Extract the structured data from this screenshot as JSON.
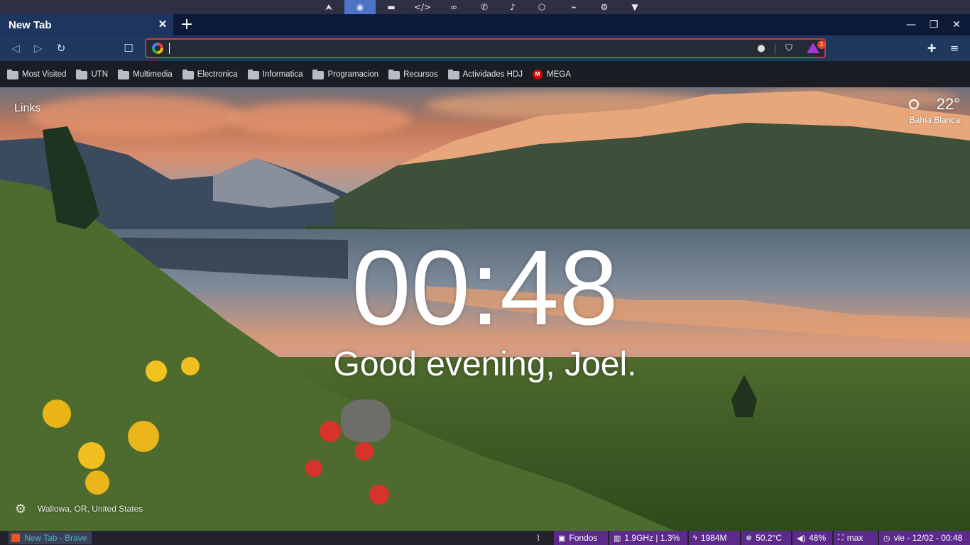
{
  "dock": {
    "items": [
      {
        "icon": "arrow-up-icon",
        "glyph": "⮝"
      },
      {
        "icon": "firefox-icon",
        "glyph": "◉",
        "active": true
      },
      {
        "icon": "folder-icon",
        "glyph": "▬"
      },
      {
        "icon": "code-icon",
        "glyph": "</>"
      },
      {
        "icon": "infinity-icon",
        "glyph": "∞"
      },
      {
        "icon": "whatsapp-icon",
        "glyph": "✆"
      },
      {
        "icon": "music-icon",
        "glyph": "♪"
      },
      {
        "icon": "cube-icon",
        "glyph": "⬡"
      },
      {
        "icon": "plug-icon",
        "glyph": "⌁"
      },
      {
        "icon": "gear-icon",
        "glyph": "⚙"
      },
      {
        "icon": "brave-icon",
        "glyph": "▼"
      }
    ]
  },
  "browser": {
    "tab_title": "New Tab",
    "close_glyph": "✕",
    "newtab_glyph": "+",
    "window_controls": {
      "minimize": "—",
      "restore": "❐",
      "close": "✕"
    }
  },
  "toolbar": {
    "back": "◁",
    "forward": "▷",
    "reload": "↻",
    "bookmark": "☐",
    "url_value": "",
    "url_placeholder": "",
    "location_glyph": "⬤",
    "shield_glyph": "⛉",
    "rewards_badge": "1",
    "extensions_glyph": "✚",
    "menu_glyph": "≡"
  },
  "bookmarks": [
    {
      "label": "Most Visited",
      "type": "folder"
    },
    {
      "label": "UTN",
      "type": "folder"
    },
    {
      "label": "Multimedia",
      "type": "folder"
    },
    {
      "label": "Electronica",
      "type": "folder"
    },
    {
      "label": "Informatica",
      "type": "folder"
    },
    {
      "label": "Programacion",
      "type": "folder"
    },
    {
      "label": "Recursos",
      "type": "folder"
    },
    {
      "label": "Actividades HDJ",
      "type": "folder"
    },
    {
      "label": "MEGA",
      "type": "link",
      "icon_text": "M"
    }
  ],
  "newtab": {
    "links_label": "Links",
    "weather_temp": "22°",
    "weather_city": "Bahía Blanca",
    "clock": "00:48",
    "greeting": "Good evening, Joel.",
    "settings_glyph": "⚙",
    "photo_location": "Wallowa, OR, United States"
  },
  "statusbar": {
    "task_label": "New Tab - Brave",
    "tray_glyph": "⌇",
    "modules": [
      {
        "name": "wallpapers",
        "icon": "▣",
        "label": "Fondos"
      },
      {
        "name": "cpu",
        "icon": "▥",
        "label": "1.9GHz | 1.3%"
      },
      {
        "name": "memory",
        "icon": "ϟ",
        "label": "1984M"
      },
      {
        "name": "temperature",
        "icon": "❄",
        "label": "50.2°C"
      },
      {
        "name": "volume",
        "icon": "◀)",
        "label": "48%"
      },
      {
        "name": "layout",
        "icon": "⛶",
        "label": "max"
      },
      {
        "name": "date",
        "icon": "◷",
        "label": "vie - 12/02 - 00:48"
      }
    ]
  },
  "colors": {
    "accent": "#5b2a8a",
    "tab_active": "#1e3560",
    "url_border": "#c2403f",
    "dock_active": "#4d74c7"
  }
}
